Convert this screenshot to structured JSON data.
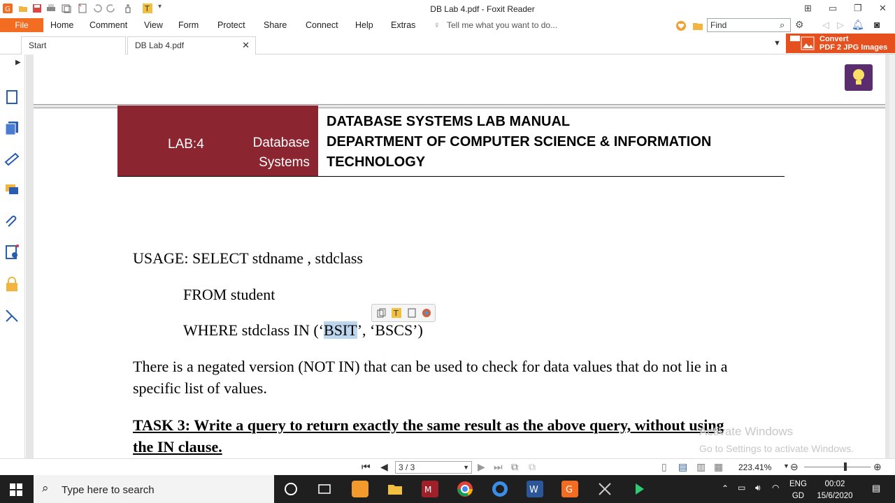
{
  "window": {
    "title": "DB Lab 4.pdf - Foxit Reader"
  },
  "menu": {
    "file": "File",
    "items": [
      "Home",
      "Comment",
      "View",
      "Form",
      "Protect",
      "Share",
      "Connect",
      "Help",
      "Extras"
    ],
    "tell_me": "Tell me what you want to do...",
    "find_placeholder": "Find"
  },
  "tabs": [
    {
      "label": "Start"
    },
    {
      "label": "DB Lab 4.pdf"
    }
  ],
  "convert_banner": {
    "line1": "Convert",
    "line2": "PDF 2 JPG Images"
  },
  "document": {
    "header_left_lab": "LAB:4",
    "header_left_subject_1": "Database",
    "header_left_subject_2": "Systems",
    "header_title_1": "DATABASE SYSTEMS LAB MANUAL",
    "header_title_2": "DEPARTMENT OF COMPUTER SCIENCE & INFORMATION",
    "header_title_3": "TECHNOLOGY",
    "usage_line": "USAGE: SELECT stdname , stdclass",
    "from_line": "FROM student",
    "where_prefix": "WHERE stdclass IN (‘",
    "where_selected": "BSIT",
    "where_suffix": "’, ‘BSCS’)",
    "negated_line_1": "There is a negated version (NOT IN) that can be used to check for data values that do not lie in a",
    "negated_line_2": "specific list of values.",
    "task3_line_1": "TASK 3: Write a query to return exactly the same result as the above query, without using",
    "task3_line_2": "the IN clause."
  },
  "watermark": {
    "line1": "Activate Windows",
    "line2": "Go to Settings to activate Windows."
  },
  "status": {
    "page": "3 / 3",
    "zoom": "223.41%"
  },
  "taskbar": {
    "search_placeholder": "Type here to search",
    "lang_1": "ENG",
    "lang_2": "GD",
    "time": "00:02",
    "date": "15/6/2020"
  },
  "colors": {
    "file_tab": "#f26c21",
    "header_box": "#8b2530",
    "selection": "#bcd6ee",
    "lightbulb_bg": "#5c2d6e",
    "convert_banner": "#e6501e"
  }
}
